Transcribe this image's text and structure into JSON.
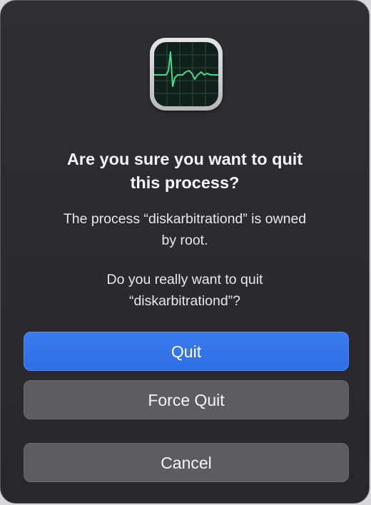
{
  "dialog": {
    "app_icon": "activity-monitor-icon",
    "title_line1": "Are you sure you want to quit",
    "title_line2": "this process?",
    "message1_line1": "The process “diskarbitrationd” is owned",
    "message1_line2": "by root.",
    "message2_line1": "Do you really want to quit",
    "message2_line2": "“diskarbitrationd”?"
  },
  "buttons": {
    "quit_label": "Quit",
    "force_quit_label": "Force Quit",
    "cancel_label": "Cancel"
  },
  "colors": {
    "dialog_background": "#2c2c30",
    "primary_button": "#3274ea",
    "secondary_button": "#5d5d61",
    "graph_line": "#4ad88a"
  }
}
